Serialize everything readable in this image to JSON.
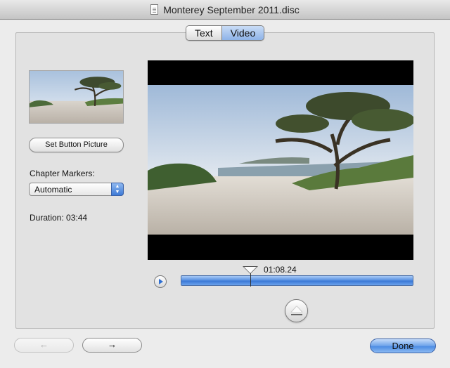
{
  "window": {
    "title": "Monterey September 2011.disc"
  },
  "tabs": [
    {
      "label": "Text",
      "selected": false
    },
    {
      "label": "Video",
      "selected": true
    }
  ],
  "left_panel": {
    "set_button_picture_label": "Set Button Picture",
    "chapter_markers_label": "Chapter Markers:",
    "chapter_markers_value": "Automatic",
    "duration_label": "Duration: 03:44"
  },
  "player": {
    "timecode": "01:08.24",
    "playhead_fraction": 0.3
  },
  "navigation": {
    "back_label": "←",
    "forward_label": "→",
    "done_label": "Done"
  },
  "colors": {
    "accent_blue": "#4d8ce3",
    "scrubber_blue": "#3a78d6",
    "sky": "#c9d9ec",
    "sand": "#cfc9c0"
  }
}
